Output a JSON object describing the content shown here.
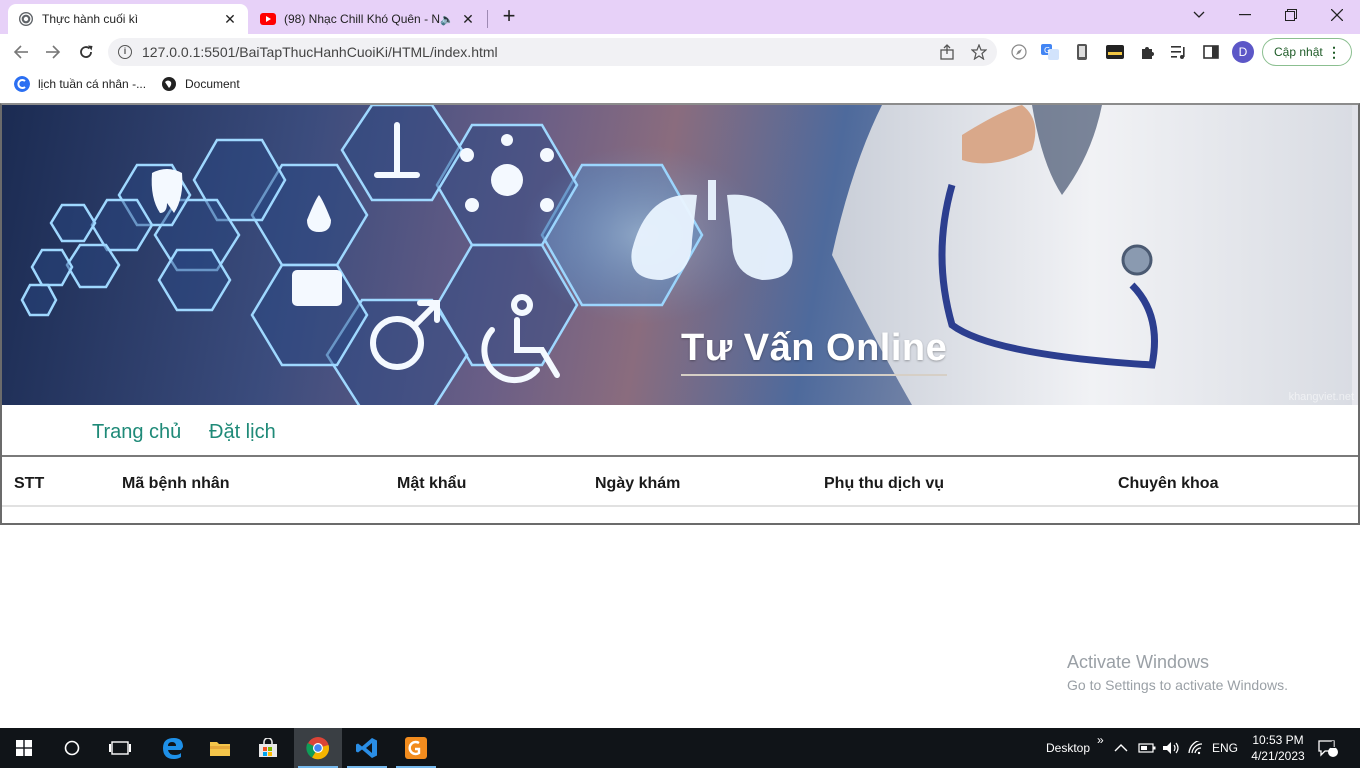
{
  "browser": {
    "tabs": [
      {
        "title": "Thực hành cuối kì",
        "active": true
      },
      {
        "title": "(98) Nhạc Chill Khó Quên - N",
        "active": false
      }
    ],
    "new_tab": "+",
    "window_controls": {
      "minimize": "—",
      "restore": "❐",
      "close": "✕",
      "dropdown": "⌄"
    },
    "address_bar": {
      "url": "127.0.0.1:5501/BaiTapThucHanhCuoiKi/HTML/index.html"
    },
    "update_button": "Cập nhật",
    "profile_initial": "D",
    "bookmarks": [
      {
        "label": "lịch tuần cá nhân -..."
      },
      {
        "label": "Document"
      }
    ]
  },
  "page": {
    "banner": {
      "title": "Tư Vấn Online",
      "watermark": "khangviet.net"
    },
    "nav": [
      {
        "label": "Trang chủ"
      },
      {
        "label": "Đặt lịch"
      }
    ],
    "table": {
      "headers": [
        "STT",
        "Mã bệnh nhân",
        "Mật khẩu",
        "Ngày khám",
        "Phụ thu dịch vụ",
        "Chuyên khoa"
      ],
      "rows": []
    }
  },
  "activate_windows": {
    "line1": "Activate Windows",
    "line2": "Go to Settings to activate Windows."
  },
  "taskbar": {
    "desktop_label": "Desktop",
    "chevron": "»",
    "language": "ENG",
    "time": "10:53 PM",
    "date": "4/21/2023",
    "notification_count": "1"
  },
  "colors": {
    "tabstrip": "#e7d1f8",
    "nav_link": "#1f8a78",
    "update_button_text": "#1e5b27",
    "taskbar": "#101418"
  }
}
